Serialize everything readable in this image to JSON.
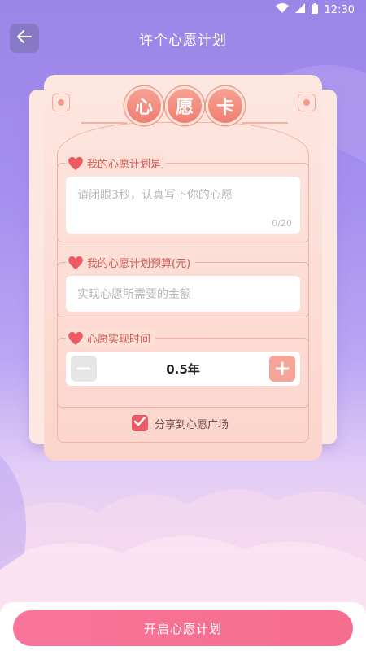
{
  "status_bar": {
    "time": "12:30",
    "icons": [
      "wifi-icon",
      "signal-icon",
      "battery-icon"
    ]
  },
  "header": {
    "title": "许个心愿计划",
    "back_icon": "arrow-left-icon"
  },
  "card": {
    "title_chars": [
      "心",
      "愿",
      "卡"
    ],
    "plan": {
      "label": "我的心愿计划是",
      "placeholder": "请闭眼3秒，认真写下你的心愿",
      "counter": "0/20"
    },
    "budget": {
      "label": "我的心愿计划预算(元)",
      "placeholder": "实现心愿所需要的金额"
    },
    "duration": {
      "label": "心愿实现时间",
      "value": "0.5年",
      "minus": "−",
      "plus": "+"
    },
    "share": {
      "label": "分享到心愿广场",
      "checked": true
    }
  },
  "footer": {
    "button_label": "开启心愿计划"
  },
  "colors": {
    "accent": "#f56e8f",
    "label": "#d15a55",
    "card": "#fde7e1",
    "heart": "#ee5a64"
  }
}
